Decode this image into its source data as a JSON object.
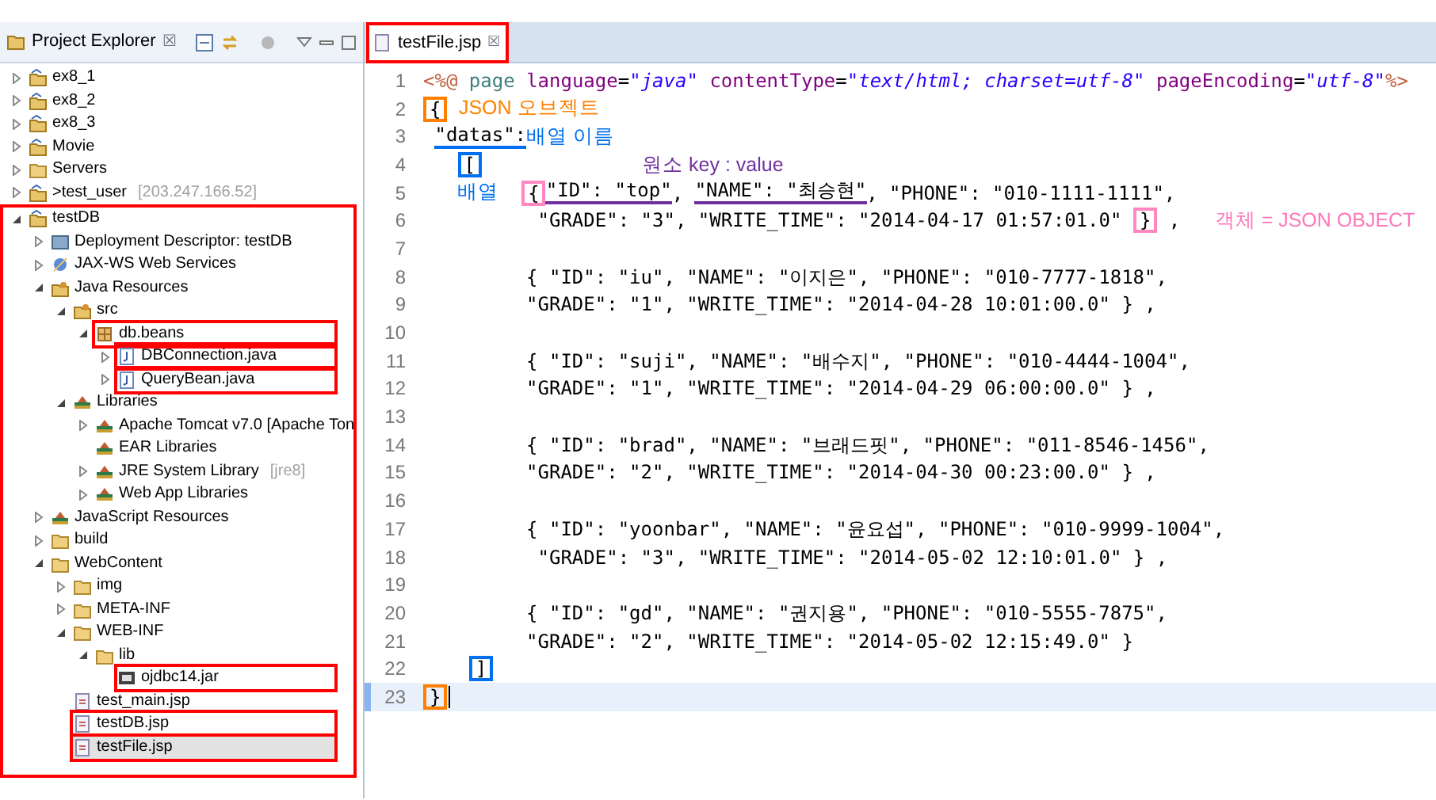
{
  "explorer": {
    "title": "Project Explorer",
    "close": "☒",
    "tree": [
      {
        "label": "ex8_1",
        "kind": "project",
        "expanded": false,
        "highlighted": false,
        "selected": false
      },
      {
        "label": "ex8_2",
        "kind": "project",
        "expanded": false,
        "highlighted": false,
        "selected": false
      },
      {
        "label": "ex8_3",
        "kind": "project",
        "expanded": false,
        "highlighted": false,
        "selected": false
      },
      {
        "label": "Movie",
        "kind": "project",
        "expanded": false,
        "highlighted": false,
        "selected": false
      },
      {
        "label": "Servers",
        "kind": "folder",
        "expanded": false,
        "highlighted": false,
        "selected": false
      },
      {
        "label": ">test_user",
        "decoration": "[203.247.166.52]",
        "kind": "project",
        "expanded": false,
        "highlighted": false,
        "selected": false
      },
      {
        "label": "testDB",
        "kind": "project",
        "expanded": true,
        "highlighted": true,
        "selected": false,
        "children": [
          {
            "label": "Deployment Descriptor: testDB",
            "kind": "descriptor",
            "expanded": false,
            "highlighted": false,
            "selected": false
          },
          {
            "label": "JAX-WS Web Services",
            "kind": "webservices",
            "expanded": false,
            "highlighted": false,
            "selected": false
          },
          {
            "label": "Java Resources",
            "kind": "javares",
            "expanded": true,
            "highlighted": false,
            "selected": false,
            "children": [
              {
                "label": "src",
                "kind": "javares",
                "expanded": true,
                "highlighted": false,
                "selected": false,
                "children": [
                  {
                    "label": "db.beans",
                    "kind": "package",
                    "expanded": true,
                    "highlighted": true,
                    "selected": false,
                    "children": [
                      {
                        "label": "DBConnection.java",
                        "kind": "java",
                        "expanded": false,
                        "highlighted": true,
                        "selected": false
                      },
                      {
                        "label": "QueryBean.java",
                        "kind": "java",
                        "expanded": false,
                        "highlighted": true,
                        "selected": false
                      }
                    ]
                  }
                ]
              },
              {
                "label": "Libraries",
                "kind": "library",
                "expanded": true,
                "highlighted": false,
                "selected": false,
                "children": [
                  {
                    "label": "Apache Tomcat v7.0 [Apache Ton",
                    "kind": "library",
                    "expanded": false,
                    "highlighted": false,
                    "selected": false
                  },
                  {
                    "label": "EAR Libraries",
                    "kind": "library",
                    "highlighted": false,
                    "selected": false
                  },
                  {
                    "label": "JRE System Library",
                    "decoration": "[jre8]",
                    "kind": "library",
                    "expanded": false,
                    "highlighted": false,
                    "selected": false
                  },
                  {
                    "label": "Web App Libraries",
                    "kind": "library",
                    "expanded": false,
                    "highlighted": false,
                    "selected": false
                  }
                ]
              }
            ]
          },
          {
            "label": "JavaScript Resources",
            "kind": "library",
            "expanded": false,
            "highlighted": false,
            "selected": false
          },
          {
            "label": "build",
            "kind": "folder",
            "expanded": false,
            "highlighted": false,
            "selected": false
          },
          {
            "label": "WebContent",
            "kind": "folder",
            "expanded": true,
            "highlighted": false,
            "selected": false,
            "children": [
              {
                "label": "img",
                "kind": "folder",
                "expanded": false,
                "highlighted": false,
                "selected": false
              },
              {
                "label": "META-INF",
                "kind": "folder",
                "expanded": false,
                "highlighted": false,
                "selected": false
              },
              {
                "label": "WEB-INF",
                "kind": "folder",
                "expanded": true,
                "highlighted": false,
                "selected": false,
                "children": [
                  {
                    "label": "lib",
                    "kind": "folder",
                    "expanded": true,
                    "highlighted": false,
                    "selected": false,
                    "children": [
                      {
                        "label": "ojdbc14.jar",
                        "kind": "jar",
                        "highlighted": true,
                        "selected": false
                      }
                    ]
                  }
                ]
              },
              {
                "label": "test_main.jsp",
                "kind": "jsp",
                "highlighted": false,
                "selected": false
              },
              {
                "label": "testDB.jsp",
                "kind": "jsp",
                "highlighted": true,
                "selected": false
              },
              {
                "label": "testFile.jsp",
                "kind": "jsp",
                "highlighted": true,
                "selected": true
              }
            ]
          }
        ]
      }
    ]
  },
  "editor": {
    "tab": {
      "label": "testFile.jsp",
      "close": "☒",
      "highlighted": true
    },
    "lines": [
      {
        "number": "1",
        "current": false,
        "segments": [
          {
            "kind": "tag",
            "text": "<%@"
          },
          {
            "kind": "keyword",
            "text": " page"
          },
          {
            "kind": "attr",
            "text": " language"
          },
          {
            "kind": "plain",
            "text": "="
          },
          {
            "kind": "string",
            "text": "\"java\""
          },
          {
            "kind": "attr",
            "text": " contentType"
          },
          {
            "kind": "plain",
            "text": "="
          },
          {
            "kind": "string",
            "text": "\"text/html; charset=utf-8\""
          },
          {
            "kind": "attr",
            "text": " pageEncoding"
          },
          {
            "kind": "plain",
            "text": "="
          },
          {
            "kind": "string",
            "text": "\"utf-8\""
          },
          {
            "kind": "tag",
            "text": "%>"
          }
        ]
      },
      {
        "number": "2",
        "current": false,
        "segments": [
          {
            "kind": "boxed",
            "text": "{",
            "color": "#ff8000"
          },
          {
            "kind": "note",
            "text": " JSON 오브젝트",
            "color": "#ff8000"
          }
        ]
      },
      {
        "number": "3",
        "current": false,
        "segments": [
          {
            "kind": "underlined",
            "text": " \"datas\":",
            "color": "#0070f0"
          },
          {
            "kind": "note",
            "text": "배열 이름",
            "color": "#0070f0"
          }
        ]
      },
      {
        "number": "4",
        "current": false,
        "segments": [
          {
            "kind": "boxed",
            "text": "   [",
            "color": "#0070f0"
          },
          {
            "kind": "note",
            "text": "              원소  key : value",
            "color": "#7030a0"
          }
        ]
      },
      {
        "number": "5",
        "current": false,
        "segments": [
          {
            "kind": "note",
            "text": "   배열  ",
            "color": "#0070f0"
          },
          {
            "kind": "boxed",
            "text": "{",
            "color": "#ff88c0"
          },
          {
            "kind": "underlined",
            "text": "\"ID\": \"top\"",
            "color": "#7030a0"
          },
          {
            "kind": "plain",
            "text": ", "
          },
          {
            "kind": "underlined",
            "text": "\"NAME\": \"최승현\"",
            "color": "#7030a0"
          },
          {
            "kind": "plain",
            "text": ", \"PHONE\": \"010-1111-1111\","
          }
        ]
      },
      {
        "number": "6",
        "current": false,
        "segments": [
          {
            "kind": "plain",
            "text": "          \"GRADE\": \"3\", \"WRITE_TIME\": \"2014-04-17 01:57:01.0\" "
          },
          {
            "kind": "boxed",
            "text": "}",
            "color": "#ff88c0"
          },
          {
            "kind": "plain",
            "text": " ,"
          },
          {
            "kind": "note",
            "text": "   객체 = JSON OBJECT",
            "color": "#ff77b8"
          }
        ]
      },
      {
        "number": "7",
        "current": false
      },
      {
        "number": "8",
        "current": false,
        "text": "         { \"ID\": \"iu\", \"NAME\": \"이지은\", \"PHONE\": \"010-7777-1818\","
      },
      {
        "number": "9",
        "current": false,
        "text": "         \"GRADE\": \"1\", \"WRITE_TIME\": \"2014-04-28 10:01:00.0\" } ,"
      },
      {
        "number": "10",
        "current": false
      },
      {
        "number": "11",
        "current": false,
        "text": "         { \"ID\": \"suji\", \"NAME\": \"배수지\", \"PHONE\": \"010-4444-1004\","
      },
      {
        "number": "12",
        "current": false,
        "text": "         \"GRADE\": \"1\", \"WRITE_TIME\": \"2014-04-29 06:00:00.0\" } ,"
      },
      {
        "number": "13",
        "current": false
      },
      {
        "number": "14",
        "current": false,
        "text": "         { \"ID\": \"brad\", \"NAME\": \"브래드핏\", \"PHONE\": \"011-8546-1456\","
      },
      {
        "number": "15",
        "current": false,
        "text": "         \"GRADE\": \"2\", \"WRITE_TIME\": \"2014-04-30 00:23:00.0\" } ,"
      },
      {
        "number": "16",
        "current": false
      },
      {
        "number": "17",
        "current": false,
        "text": "         { \"ID\": \"yoonbar\", \"NAME\": \"윤요섭\", \"PHONE\": \"010-9999-1004\","
      },
      {
        "number": "18",
        "current": false,
        "text": "          \"GRADE\": \"3\", \"WRITE_TIME\": \"2014-05-02 12:10:01.0\" } ,"
      },
      {
        "number": "19",
        "current": false
      },
      {
        "number": "20",
        "current": false,
        "text": "         { \"ID\": \"gd\", \"NAME\": \"권지용\", \"PHONE\": \"010-5555-7875\","
      },
      {
        "number": "21",
        "current": false,
        "text": "         \"GRADE\": \"2\", \"WRITE_TIME\": \"2014-05-02 12:15:49.0\" }"
      },
      {
        "number": "22",
        "current": false,
        "segments": [
          {
            "kind": "boxed",
            "text": "    ]",
            "color": "#0070f0"
          }
        ]
      },
      {
        "number": "23",
        "current": true,
        "segments": [
          {
            "kind": "boxed",
            "text": "}",
            "color": "#ff8000"
          }
        ]
      }
    ]
  }
}
